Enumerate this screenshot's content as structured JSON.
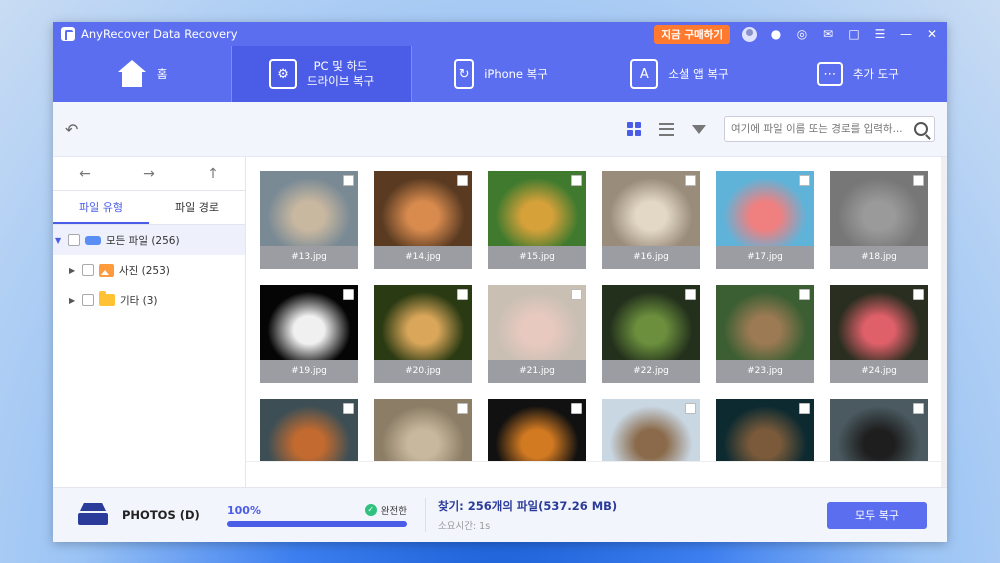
{
  "app": {
    "title": "AnyRecover Data Recovery",
    "buy_label": "지금 구매하기"
  },
  "nav": {
    "home": "홈",
    "pc_line1": "PC 및 하드",
    "pc_line2": "드라이브 복구",
    "iphone": "iPhone 복구",
    "social": "소셜 앱 복구",
    "tools": "추가 도구"
  },
  "search": {
    "placeholder": "여기에 파일 이름 또는 경로를 입력하..."
  },
  "sidebar": {
    "tab_type": "파일 유형",
    "tab_path": "파일 경로",
    "tree": [
      {
        "label": "모든 파일 (256)"
      },
      {
        "label": "사진 (253)"
      },
      {
        "label": "기타 (3)"
      }
    ]
  },
  "files": [
    "#13.jpg",
    "#14.jpg",
    "#15.jpg",
    "#16.jpg",
    "#17.jpg",
    "#18.jpg",
    "#19.jpg",
    "#20.jpg",
    "#21.jpg",
    "#22.jpg",
    "#23.jpg",
    "#24.jpg",
    "",
    "",
    "",
    "",
    "",
    ""
  ],
  "status": {
    "drive": "PHOTOS (D)",
    "progress_label": "100%",
    "progress": 1.0,
    "complete": "완전한",
    "found": "찾기: 256개의 파일(537.26 MB)",
    "elapsed": "소요시간: 1s",
    "recover_all": "모두 복구"
  },
  "colors": {
    "accent": "#5b6ef0",
    "buy": "#ff7a2e",
    "ok": "#2ec27e"
  }
}
